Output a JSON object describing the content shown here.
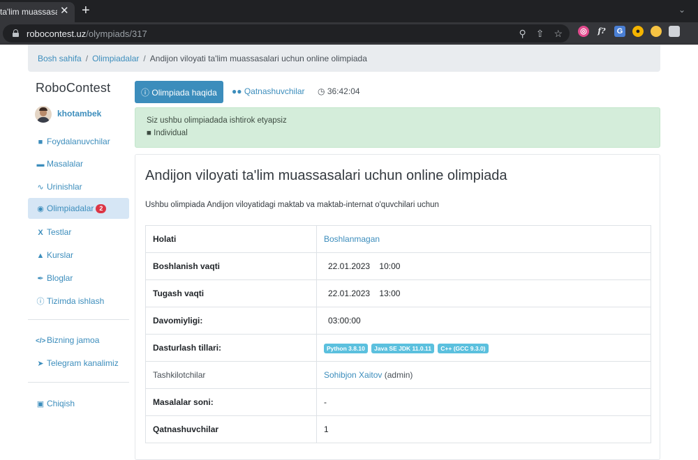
{
  "browser": {
    "tab_title": "ta'lim muassasalari",
    "tab_close": "✕",
    "new_tab": "+",
    "url_host": "robocontest.uz",
    "url_path": "/olympiads/317"
  },
  "breadcrumb": {
    "home": "Bosh sahifa",
    "olympiads": "Olimpiadalar",
    "current": "Andijon viloyati ta'lim muassasalari uchun online olimpiada"
  },
  "sidebar": {
    "brand": "RoboContest",
    "username": "khotambek",
    "items": [
      {
        "label": "Foydalanuvchilar",
        "icon": "user-icon"
      },
      {
        "label": "Masalalar",
        "icon": "book-icon"
      },
      {
        "label": "Urinishlar",
        "icon": "pulse-icon"
      },
      {
        "label": "Olimpiadalar",
        "icon": "medal-icon",
        "badge": "2"
      },
      {
        "label": "Testlar",
        "icon": "subscript-icon"
      },
      {
        "label": "Kurslar",
        "icon": "graduation-cap-icon"
      },
      {
        "label": "Bloglar",
        "icon": "feather-icon"
      },
      {
        "label": "Tizimda ishlash",
        "icon": "info-icon"
      }
    ],
    "extra": [
      {
        "label": "Bizning jamoa",
        "icon": "code-icon"
      },
      {
        "label": "Telegram kanalimiz",
        "icon": "telegram-icon"
      }
    ],
    "logout": "Chiqish"
  },
  "tabs": {
    "about": "Olimpiada haqida",
    "participants": "Qatnashuvchilar",
    "timer": "36:42:04"
  },
  "alert": {
    "line1": "Siz ushbu olimpiadada ishtirok etyapsiz",
    "line2": "Individual"
  },
  "olympiad": {
    "title": "Andijon viloyati ta'lim muassasalari uchun online olimpiada",
    "description": "Ushbu olimpiada Andijon viloyatidagi maktab va maktab-internat o'quvchilari uchun",
    "rows": {
      "status": {
        "key": "Holati",
        "value": "Boshlanmagan"
      },
      "start": {
        "key": "Boshlanish vaqti",
        "value": "22.01.2023    10:00"
      },
      "end": {
        "key": "Tugash vaqti",
        "value": "22.01.2023    13:00"
      },
      "duration": {
        "key": "Davomiyligi:",
        "value": "03:00:00"
      },
      "languages": {
        "key": "Dasturlash tillari:",
        "values": [
          "Python 3.8.10",
          "Java SE JDK 11.0.11",
          "C++ (GCC 9.3.0)"
        ]
      },
      "organizers": {
        "key": "Tashkilotchilar",
        "name": "Sohibjon Xaitov",
        "role": "(admin)"
      },
      "problems": {
        "key": "Masalalar soni:",
        "value": "-"
      },
      "participants": {
        "key": "Qatnashuvchilar",
        "value": "1"
      }
    }
  },
  "colors": {
    "primary": "#3c8dbc",
    "alert_bg": "#d4edda",
    "badge": "#dc3545",
    "lang_badge": "#5bc0de"
  }
}
